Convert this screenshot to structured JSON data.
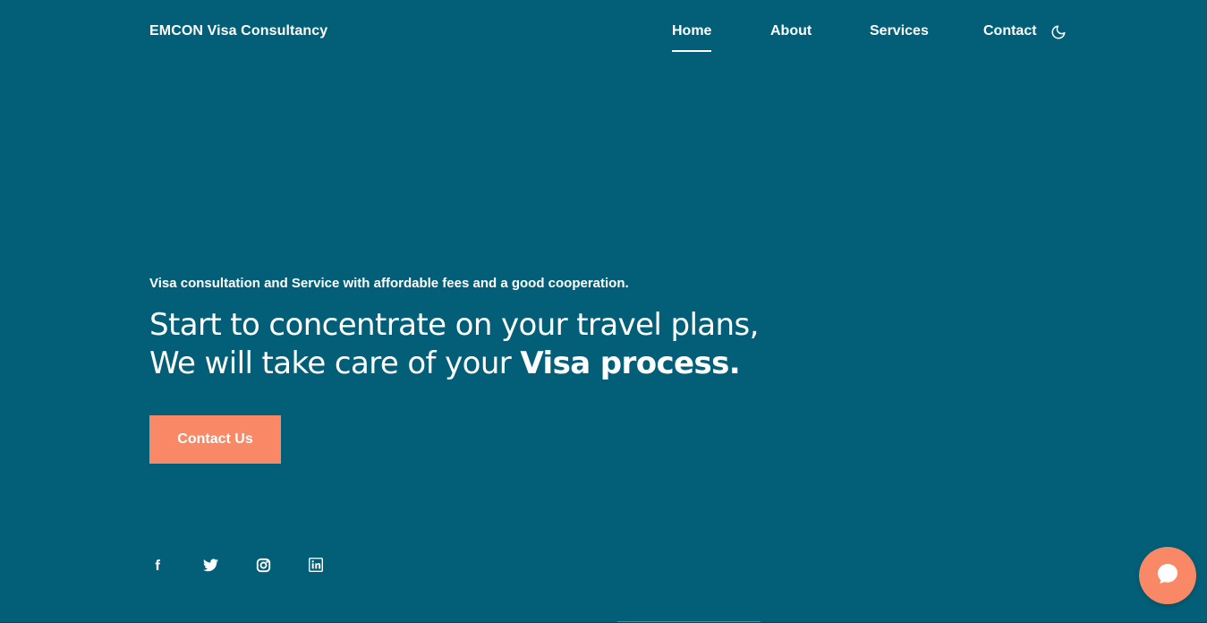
{
  "header": {
    "brand": "EMCON Visa Consultancy",
    "nav": {
      "home": "Home",
      "about": "About",
      "services": "Services",
      "contact": "Contact"
    },
    "theme_toggle_icon": "moon-icon"
  },
  "hero": {
    "tagline": "Visa consultation and Service with affordable fees and a good cooperation.",
    "headline_line1": "Start to concentrate on your travel plans,",
    "headline_line2_prefix": "We will take care of your ",
    "headline_line2_bold": "Visa process",
    "headline_line2_suffix": ".",
    "cta_label": "Contact Us"
  },
  "socials": [
    "facebook-icon",
    "twitter-icon",
    "instagram-icon",
    "linkedin-icon"
  ],
  "chat_icon": "chat-bubble-icon",
  "colors": {
    "background": "#025f77",
    "accent": "#f98866",
    "text": "#ffffff"
  }
}
